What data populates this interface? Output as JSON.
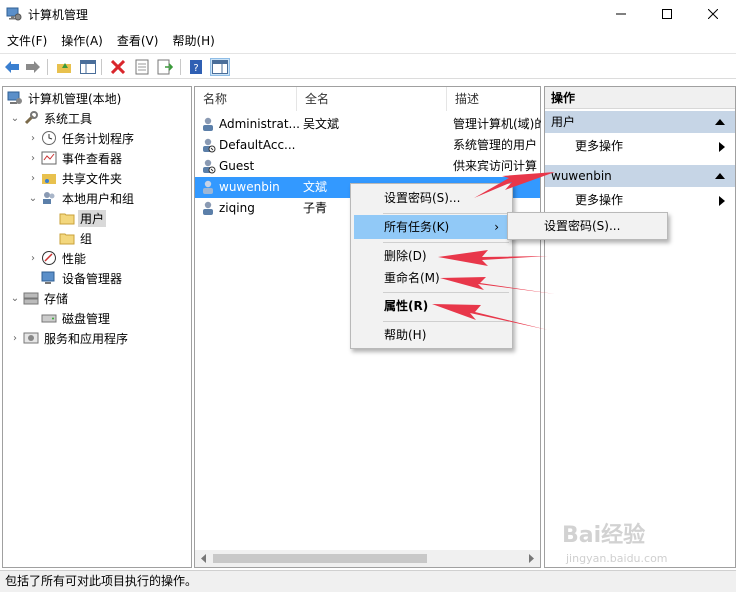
{
  "window": {
    "title": "计算机管理"
  },
  "menubar": [
    "文件(F)",
    "操作(A)",
    "查看(V)",
    "帮助(H)"
  ],
  "tree": {
    "root": "计算机管理(本地)",
    "system_tools": "系统工具",
    "task_scheduler": "任务计划程序",
    "event_viewer": "事件查看器",
    "shared_folders": "共享文件夹",
    "local_users_groups": "本地用户和组",
    "users": "用户",
    "groups": "组",
    "performance": "性能",
    "device_manager": "设备管理器",
    "storage": "存储",
    "disk_management": "磁盘管理",
    "services_apps": "服务和应用程序"
  },
  "list": {
    "columns": [
      "名称",
      "全名",
      "描述"
    ],
    "rows": [
      {
        "name": "Administrat...",
        "fullname": "吴文斌",
        "desc": "管理计算机(域)的"
      },
      {
        "name": "DefaultAcc...",
        "fullname": "",
        "desc": "系统管理的用户"
      },
      {
        "name": "Guest",
        "fullname": "",
        "desc": "供来宾访问计算"
      },
      {
        "name": "wuwenbin",
        "fullname": "文斌",
        "desc": ""
      },
      {
        "name": "ziqing",
        "fullname": "子青",
        "desc": ""
      }
    ]
  },
  "actions": {
    "header": "操作",
    "group1": "用户",
    "group1_more": "更多操作",
    "group2": "wuwenbin",
    "group2_more": "更多操作"
  },
  "context_menu": {
    "set_password": "设置密码(S)...",
    "all_tasks": "所有任务(K)",
    "delete": "删除(D)",
    "rename": "重命名(M)",
    "properties": "属性(R)",
    "help": "帮助(H)"
  },
  "submenu": {
    "set_password": "设置密码(S)..."
  },
  "status": "包括了所有可对此项目执行的操作。",
  "watermark": {
    "brand": "Bai经验",
    "url": "jingyan.baidu.com"
  },
  "colors": {
    "selection": "#cce8ff",
    "menu_highlight": "#91c9f7",
    "action_group": "#c6d5e6",
    "arrow": "#e8374a"
  }
}
